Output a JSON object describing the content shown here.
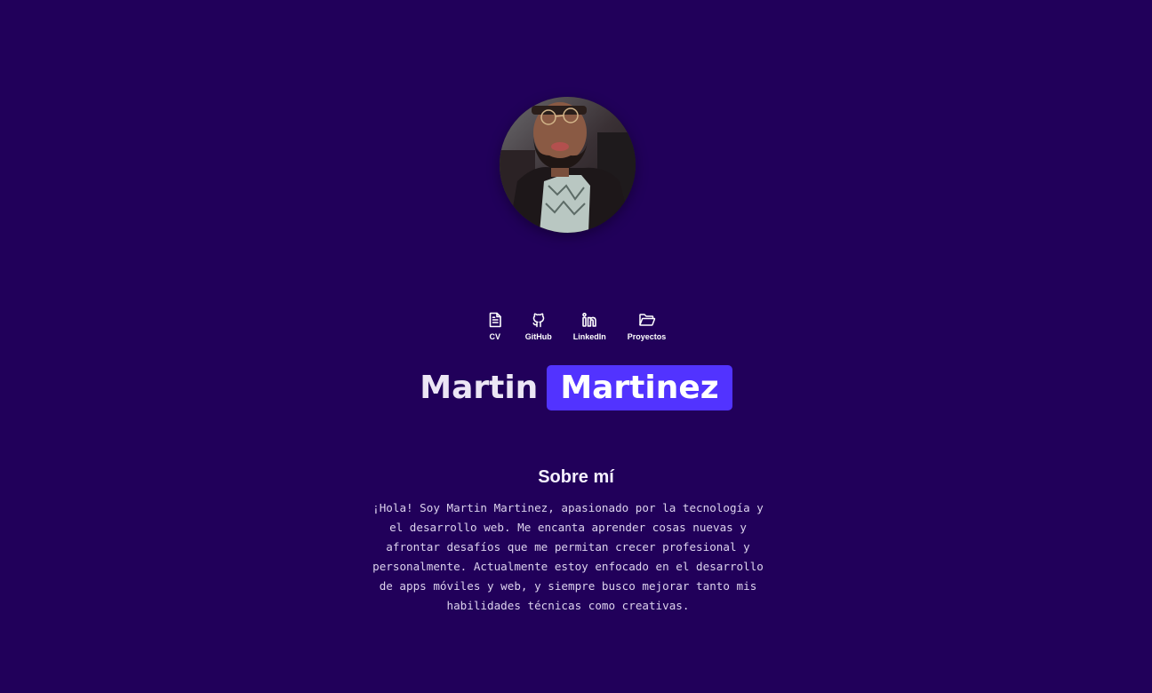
{
  "profile": {
    "photo_alt": "Foto de perfil de Martin Martinez",
    "first_name": "Martin",
    "last_name": "Martinez"
  },
  "nav": {
    "items": [
      {
        "label": "CV",
        "icon": "file-text-icon"
      },
      {
        "label": "GitHub",
        "icon": "github-icon"
      },
      {
        "label": "LinkedIn",
        "icon": "linkedin-icon"
      },
      {
        "label": "Proyectos",
        "icon": "folder-icon"
      }
    ]
  },
  "about": {
    "title": "Sobre mí",
    "text": "¡Hola! Soy Martin Martinez, apasionado por la tecnología y el desarrollo web. Me encanta aprender cosas nuevas y afrontar desafíos que me permitan crecer profesional y personalmente. Actualmente estoy enfocado en el desarrollo de apps móviles y web, y siempre busco mejorar tanto mis habilidades técnicas como creativas."
  },
  "colors": {
    "background": "#21005a",
    "accent": "#5233ff",
    "text": "#ffffff"
  }
}
